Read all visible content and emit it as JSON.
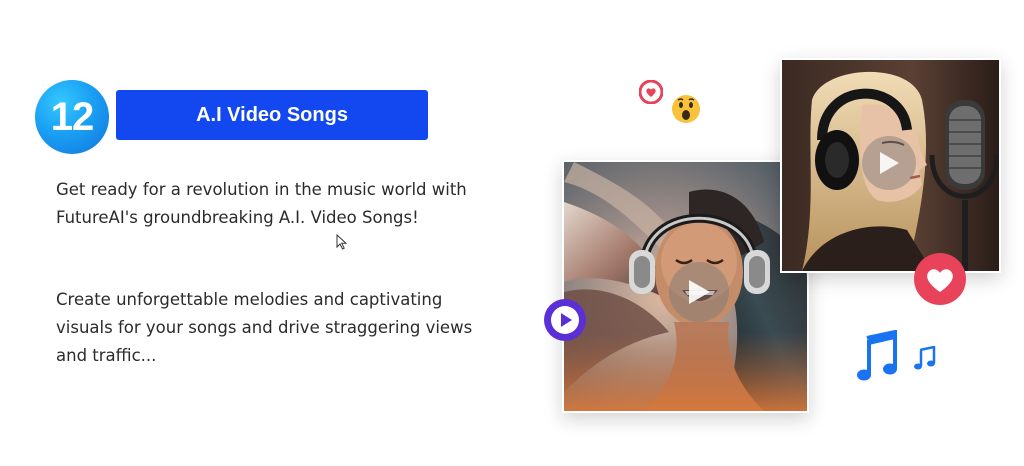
{
  "feature": {
    "number": "12",
    "title": "A.I Video Songs"
  },
  "description": {
    "paragraph_1": "Get ready for a revolution in the music world with FutureAI's groundbreaking A.I. Video Songs!",
    "paragraph_2": "Create unforgettable melodies and captivating visuals for your songs and drive straggering views and traffic..."
  },
  "icons": {
    "number_badge": "number-badge",
    "cursor": "mouse-cursor-icon",
    "heart_small": "heart-reaction-icon",
    "wow": "wow-emoji-icon",
    "heart_big": "heart-reaction-icon",
    "play_purple": "play-icon",
    "music_note_big": "music-note-icon",
    "music_note_small": "music-note-icon",
    "video_play": "play-icon"
  },
  "colors": {
    "title_bar": "#1347f0",
    "badge": "#1aa0f3",
    "heart": "#e8435a",
    "play_purple": "#5a2fd6",
    "music_notes": "#1a73f0",
    "text": "#2b2b2b"
  }
}
